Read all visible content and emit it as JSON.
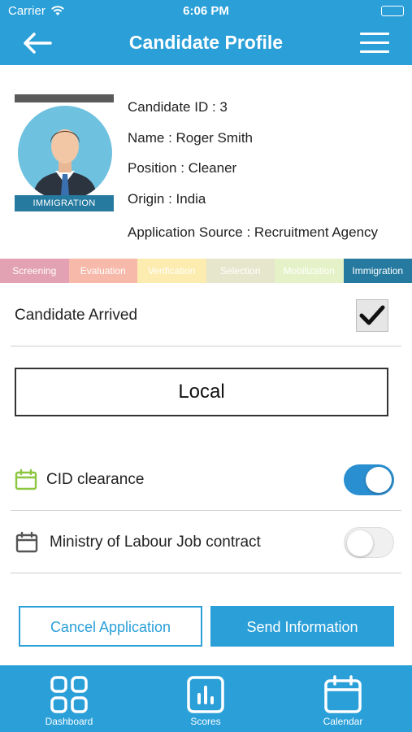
{
  "status_bar": {
    "carrier": "Carrier",
    "time": "6:06 PM"
  },
  "header": {
    "title": "Candidate Profile",
    "back_icon": "back-arrow-icon",
    "menu_icon": "hamburger-menu-icon"
  },
  "candidate": {
    "photo_tag": "IMMIGRATION",
    "id_line": "Candidate ID : 3",
    "name_line": "Name : Roger Smith",
    "position_line": "Position : Cleaner",
    "origin_line": "Origin : India",
    "source_line": "Application Source : Recruitment Agency"
  },
  "stages": [
    {
      "label": "Screening",
      "color": "#e2a2b3"
    },
    {
      "label": "Evaluation",
      "color": "#f6b9aa"
    },
    {
      "label": "Verification",
      "color": "#fcecaf"
    },
    {
      "label": "Selection",
      "color": "#e6e6cc"
    },
    {
      "label": "Mobilization",
      "color": "#e5f2c8"
    },
    {
      "label": "Immigration",
      "color": "#267aa0"
    }
  ],
  "arrival": {
    "label": "Candidate Arrived",
    "checked": true
  },
  "local_button": "Local",
  "clearances": [
    {
      "label": "CID clearance",
      "icon": "calendar-icon",
      "icon_color": "#8cc63f",
      "enabled": true
    },
    {
      "label": "Ministry of Labour Job contract",
      "icon": "calendar-icon",
      "icon_color": "#555555",
      "enabled": false
    }
  ],
  "actions": {
    "cancel": "Cancel Application",
    "send": "Send Information"
  },
  "tabs": [
    {
      "label": "Dashboard",
      "icon": "dashboard-grid-icon"
    },
    {
      "label": "Scores",
      "icon": "bar-chart-icon"
    },
    {
      "label": "Calendar",
      "icon": "calendar-icon"
    }
  ],
  "colors": {
    "primary": "#2a9fd8",
    "toggle_on": "#2a8fd0"
  }
}
